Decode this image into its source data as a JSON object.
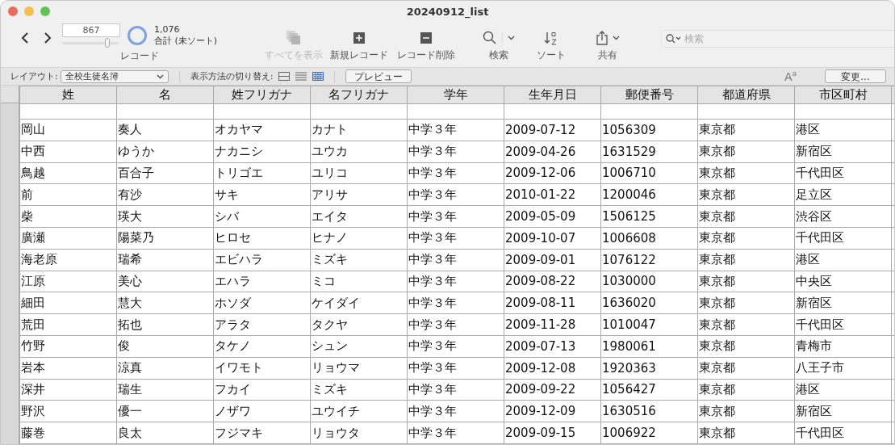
{
  "window": {
    "title": "20240912_list"
  },
  "record_nav": {
    "current": "867",
    "level": 0.8,
    "total": "1,076",
    "sort_state": "合計 (未ソート)",
    "label": "レコード"
  },
  "toolbar": [
    {
      "kind": "show-all",
      "label": "すべてを表示",
      "disabled": true
    },
    {
      "kind": "new",
      "label": "新規レコード",
      "disabled": false
    },
    {
      "kind": "delete",
      "label": "レコード削除",
      "disabled": false
    },
    {
      "kind": "find",
      "label": "検索",
      "disabled": false
    },
    {
      "kind": "sort",
      "label": "ソート",
      "disabled": false
    },
    {
      "kind": "share",
      "label": "共有",
      "disabled": false
    }
  ],
  "search": {
    "placeholder": "検索"
  },
  "layout_bar": {
    "layout_label": "レイアウト:",
    "layout_value": "全校生徒名簿",
    "view_label": "表示方法の切り替え:",
    "views": [
      {
        "kind": "form",
        "selected": false
      },
      {
        "kind": "list",
        "selected": false
      },
      {
        "kind": "table",
        "selected": true
      }
    ],
    "preview": "プレビュー",
    "text_size": "A$^{a}$",
    "change": "変更..."
  },
  "table": {
    "columns": [
      "姓",
      "名",
      "姓フリガナ",
      "名フリガナ",
      "学年",
      "生年月日",
      "郵便番号",
      "都道府県",
      "市区町村"
    ],
    "rows": [
      [
        "岡山",
        "奏人",
        "オカヤマ",
        "カナト",
        "中学３年",
        "2009-07-12",
        "1056309",
        "東京都",
        "港区"
      ],
      [
        "中西",
        "ゆうか",
        "ナカニシ",
        "ユウカ",
        "中学３年",
        "2009-04-26",
        "1631529",
        "東京都",
        "新宿区"
      ],
      [
        "鳥越",
        "百合子",
        "トリゴエ",
        "ユリコ",
        "中学３年",
        "2009-12-06",
        "1006710",
        "東京都",
        "千代田区"
      ],
      [
        "前",
        "有沙",
        "サキ",
        "アリサ",
        "中学３年",
        "2010-01-22",
        "1200046",
        "東京都",
        "足立区"
      ],
      [
        "柴",
        "瑛大",
        "シバ",
        "エイタ",
        "中学３年",
        "2009-05-09",
        "1506125",
        "東京都",
        "渋谷区"
      ],
      [
        "廣瀬",
        "陽菜乃",
        "ヒロセ",
        "ヒナノ",
        "中学３年",
        "2009-10-07",
        "1006608",
        "東京都",
        "千代田区"
      ],
      [
        "海老原",
        "瑞希",
        "エビハラ",
        "ミズキ",
        "中学３年",
        "2009-09-01",
        "1076122",
        "東京都",
        "港区"
      ],
      [
        "江原",
        "美心",
        "エハラ",
        "ミコ",
        "中学３年",
        "2009-08-22",
        "1030000",
        "東京都",
        "中央区"
      ],
      [
        "細田",
        "慧大",
        "ホソダ",
        "ケイダイ",
        "中学３年",
        "2009-08-11",
        "1636020",
        "東京都",
        "新宿区"
      ],
      [
        "荒田",
        "拓也",
        "アラタ",
        "タクヤ",
        "中学３年",
        "2009-11-28",
        "1010047",
        "東京都",
        "千代田区"
      ],
      [
        "竹野",
        "俊",
        "タケノ",
        "シュン",
        "中学３年",
        "2009-07-13",
        "1980061",
        "東京都",
        "青梅市"
      ],
      [
        "岩本",
        "涼真",
        "イワモト",
        "リョウマ",
        "中学３年",
        "2009-12-08",
        "1920363",
        "東京都",
        "八王子市"
      ],
      [
        "深井",
        "瑞生",
        "フカイ",
        "ミズキ",
        "中学３年",
        "2009-09-22",
        "1056427",
        "東京都",
        "港区"
      ],
      [
        "野沢",
        "優一",
        "ノザワ",
        "ユウイチ",
        "中学３年",
        "2009-12-09",
        "1630516",
        "東京都",
        "新宿区"
      ],
      [
        "藤巻",
        "良太",
        "フジマキ",
        "リョウタ",
        "中学３年",
        "2009-09-15",
        "1006922",
        "東京都",
        "千代田区"
      ]
    ]
  }
}
